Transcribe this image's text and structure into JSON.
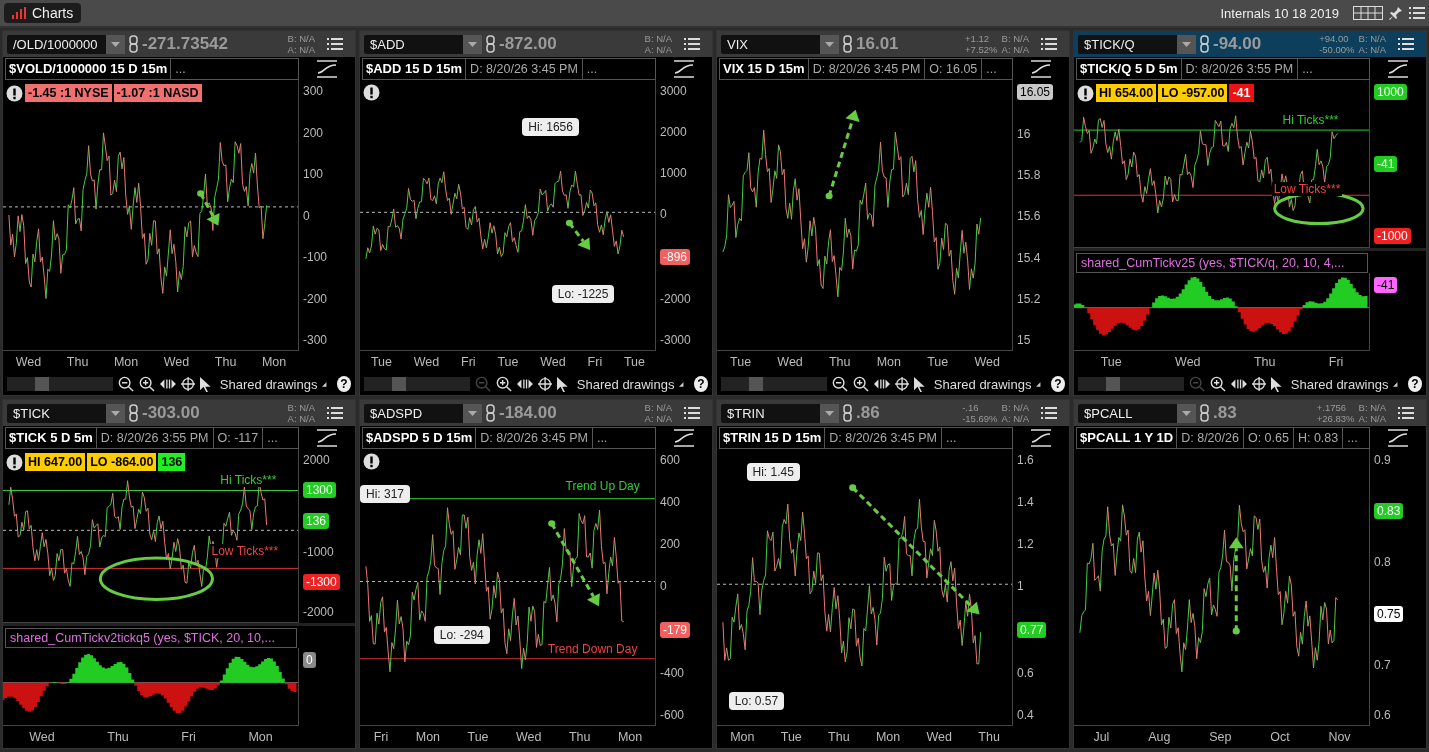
{
  "app": {
    "title": "Charts",
    "workspace": "Internals 10 18 2019"
  },
  "panels": [
    {
      "symbol": "/OLD/1000000",
      "price": "-271.73542",
      "bid": "B: N/A",
      "ask": "A: N/A",
      "selected": false,
      "title": "$VOLD/1000000 15 D 15m",
      "fields": [
        "..."
      ],
      "alert": true,
      "badges": [
        {
          "text": "-1.45 :1 NYSE",
          "color": "#f07070"
        },
        {
          "text": "-1.07 :1 NASD",
          "color": "#f07070"
        }
      ],
      "y_axis": [
        {
          "kind": "tick",
          "text": "300"
        },
        {
          "kind": "tick",
          "text": "200"
        },
        {
          "kind": "tick",
          "text": "100"
        },
        {
          "kind": "tick",
          "text": "0"
        },
        {
          "kind": "tick",
          "text": "-100"
        },
        {
          "kind": "tick",
          "text": "-200"
        },
        {
          "kind": "tick",
          "text": "-300"
        }
      ],
      "x_ticks": [
        "Wed",
        "Thu",
        "Mon",
        "Wed",
        "Thu",
        "Mon"
      ],
      "footer": {
        "label": "Shared drawings",
        "zoom_out_disabled": false,
        "help": "?"
      }
    },
    {
      "symbol": "$ADD",
      "price": "-872.00",
      "bid": "B: N/A",
      "ask": "A: N/A",
      "selected": false,
      "title": "$ADD 15 D 15m",
      "fields": [
        "D: 8/20/26 3:45 PM",
        "..."
      ],
      "alert": true,
      "y_axis": [
        {
          "kind": "tick",
          "text": "3000"
        },
        {
          "kind": "tick",
          "text": "2000"
        },
        {
          "kind": "tick",
          "text": "1000"
        },
        {
          "kind": "tick",
          "text": "0"
        },
        {
          "kind": "tag",
          "text": "-896",
          "color": "#f06060"
        },
        {
          "kind": "tick",
          "text": "-2000"
        },
        {
          "kind": "tick",
          "text": "-3000"
        }
      ],
      "x_ticks": [
        "Tue",
        "Wed",
        "Fri",
        "Tue",
        "Wed",
        "Fri",
        "Tue"
      ],
      "notes": [
        {
          "kind": "bubble",
          "text": "Hi: 1656"
        },
        {
          "kind": "bubble",
          "text": "Lo: -1225"
        }
      ],
      "footer": {
        "label": "Shared drawings",
        "zoom_out_disabled": true,
        "help": "?"
      }
    },
    {
      "symbol": "VIX",
      "price": "16.01",
      "change": [
        "+1.12",
        "+7.52%"
      ],
      "bid": "B: N/A",
      "ask": "A: N/A",
      "selected": false,
      "title": "VIX 15 D 15m",
      "fields": [
        "D: 8/20/26 3:45 PM",
        "O: 16.05",
        "..."
      ],
      "y_axis": [
        {
          "kind": "tag",
          "text": "16.05",
          "color": "#c8c8c8"
        },
        {
          "kind": "tick",
          "text": "16"
        },
        {
          "kind": "tick",
          "text": "15.8"
        },
        {
          "kind": "tick",
          "text": "15.6"
        },
        {
          "kind": "tick",
          "text": "15.4"
        },
        {
          "kind": "tick",
          "text": "15.2"
        },
        {
          "kind": "tick",
          "text": "15"
        }
      ],
      "x_ticks": [
        "Tue",
        "Wed",
        "Thu",
        "Mon",
        "Tue",
        "Wed"
      ],
      "footer": {
        "label": "Shared drawings",
        "zoom_out_disabled": false,
        "help": "?"
      }
    },
    {
      "symbol": "$TICK/Q",
      "price": "-94.00",
      "change": [
        "+94.00",
        "-50.00%"
      ],
      "bid": "B: N/A",
      "ask": "A: N/A",
      "selected": true,
      "title": "$TICK/Q 5 D 5m",
      "fields": [
        "D: 8/20/26 3:55 PM",
        "..."
      ],
      "alert": true,
      "badges": [
        {
          "text": "HI 654.00",
          "color": "#ffcc00"
        },
        {
          "text": "LO -957.00",
          "color": "#ffcc00"
        },
        {
          "text": "-41",
          "color": "#ee1111"
        }
      ],
      "y_axis": [
        {
          "kind": "tag",
          "text": "1000",
          "color": "#22cc22"
        },
        {
          "kind": "tag",
          "text": "-41",
          "color": "#22cc22"
        },
        {
          "kind": "tag",
          "text": "-1000",
          "color": "#ee2222"
        }
      ],
      "x_ticks": [
        "Tue",
        "Wed",
        "Thu",
        "Fri"
      ],
      "notes": [
        {
          "kind": "label",
          "text": "Hi Ticks***",
          "color": "#33cc33"
        },
        {
          "kind": "label",
          "text": "Low Ticks***",
          "color": "#ee4444"
        }
      ],
      "study": {
        "label": "shared_CumTickv25 (yes, $TICK/q, 20, 10, 4,...",
        "y_axis": [
          {
            "kind": "tag",
            "text": "-41",
            "color": "#ff66ff"
          }
        ]
      },
      "footer": {
        "label": "Shared drawings",
        "zoom_out_disabled": true,
        "help": "?"
      }
    },
    {
      "symbol": "$TICK",
      "price": "-303.00",
      "bid": "B: N/A",
      "ask": "A: N/A",
      "selected": false,
      "title": "$TICK 5 D 5m",
      "fields": [
        "D: 8/20/26 3:55 PM",
        "O: -117",
        "..."
      ],
      "alert": true,
      "badges": [
        {
          "text": "HI 647.00",
          "color": "#ffcc00"
        },
        {
          "text": "LO -864.00",
          "color": "#ffcc00"
        },
        {
          "text": "136",
          "color": "#22ee22"
        }
      ],
      "y_axis": [
        {
          "kind": "tick",
          "text": "2000"
        },
        {
          "kind": "tag",
          "text": "1300",
          "color": "#22cc22"
        },
        {
          "kind": "tag",
          "text": "136",
          "color": "#22cc22"
        },
        {
          "kind": "tick",
          "text": "-1000"
        },
        {
          "kind": "tag",
          "text": "-1300",
          "color": "#ee2222"
        },
        {
          "kind": "tick",
          "text": "-2000"
        }
      ],
      "x_ticks": [
        "Wed",
        "Thu",
        "Fri",
        "Mon"
      ],
      "notes": [
        {
          "kind": "label",
          "text": "Hi Ticks***",
          "color": "#33cc33"
        },
        {
          "kind": "label",
          "text": "Low Ticks***",
          "color": "#ee4444"
        }
      ],
      "study": {
        "label": "shared_CumTickv2tickq5 (yes, $TICK, 20, 10,...",
        "y_axis": [
          {
            "kind": "tag",
            "text": "0",
            "color": "#8a8a8a"
          }
        ]
      }
    },
    {
      "symbol": "$ADSPD",
      "price": "-184.00",
      "bid": "B: N/A",
      "ask": "A: N/A",
      "selected": false,
      "title": "$ADSPD 5 D 15m",
      "fields": [
        "D: 8/20/26 3:45 PM",
        "..."
      ],
      "alert": true,
      "y_axis": [
        {
          "kind": "tick",
          "text": "600"
        },
        {
          "kind": "tick",
          "text": "400"
        },
        {
          "kind": "tick",
          "text": "200"
        },
        {
          "kind": "tick",
          "text": "0"
        },
        {
          "kind": "tag",
          "text": "-179",
          "color": "#f06060"
        },
        {
          "kind": "tick",
          "text": "-400"
        },
        {
          "kind": "tick",
          "text": "-600"
        }
      ],
      "x_ticks": [
        "Fri",
        "Mon",
        "Tue",
        "Wed",
        "Thu",
        "Mon"
      ],
      "notes": [
        {
          "kind": "bubble",
          "text": "Hi: 317"
        },
        {
          "kind": "label",
          "text": "Trend Up Day",
          "color": "#33cc33"
        },
        {
          "kind": "bubble",
          "text": "Lo: -294"
        },
        {
          "kind": "label",
          "text": "Trend Down Day",
          "color": "#ee4444"
        }
      ]
    },
    {
      "symbol": "$TRIN",
      "price": ".86",
      "change": [
        "-.16",
        "-15.69%"
      ],
      "bid": "B: N/A",
      "ask": "A: N/A",
      "selected": false,
      "title": "$TRIN 15 D 15m",
      "fields": [
        "D: 8/20/26 3:45 PM",
        "..."
      ],
      "y_axis": [
        {
          "kind": "tick",
          "text": "1.6"
        },
        {
          "kind": "tick",
          "text": "1.4"
        },
        {
          "kind": "tick",
          "text": "1.2"
        },
        {
          "kind": "tick",
          "text": "1"
        },
        {
          "kind": "tag",
          "text": "0.77",
          "color": "#22cc22"
        },
        {
          "kind": "tick",
          "text": "0.6"
        },
        {
          "kind": "tick",
          "text": "0.4"
        }
      ],
      "x_ticks": [
        "Mon",
        "Tue",
        "Thu",
        "Mon",
        "Wed",
        "Thu"
      ],
      "notes": [
        {
          "kind": "bubble",
          "text": "Hi: 1.45"
        },
        {
          "kind": "bubble",
          "text": "Lo: 0.57"
        }
      ]
    },
    {
      "symbol": "$PCALL",
      "price": ".83",
      "change": [
        "+.1756",
        "+26.83%"
      ],
      "bid": "B: N/A",
      "ask": "A: N/A",
      "selected": false,
      "title": "$PCALL 1 Y 1D",
      "fields": [
        "D: 8/20/26",
        "O: 0.65",
        "H: 0.83",
        "..."
      ],
      "y_axis": [
        {
          "kind": "tick",
          "text": "0.9"
        },
        {
          "kind": "tag",
          "text": "0.83",
          "color": "#22cc22"
        },
        {
          "kind": "tick",
          "text": "0.8"
        },
        {
          "kind": "tag",
          "text": "0.75",
          "color": "#ffffff"
        },
        {
          "kind": "tick",
          "text": "0.7"
        },
        {
          "kind": "tick",
          "text": "0.6"
        }
      ],
      "x_ticks": [
        "Jul",
        "Aug",
        "Sep",
        "Oct",
        "Nov"
      ]
    }
  ]
}
